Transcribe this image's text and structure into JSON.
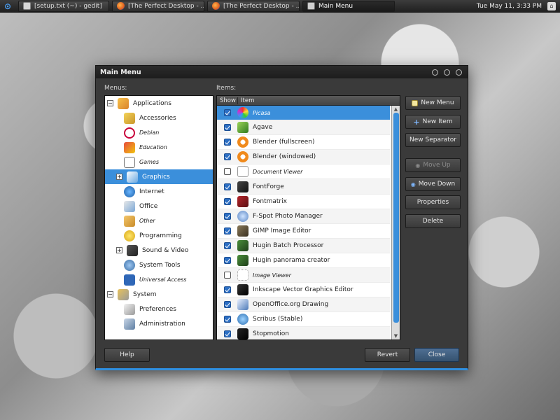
{
  "panel": {
    "tasks": [
      {
        "label": "[setup.txt (~) - gedit]",
        "icon": "document-icon"
      },
      {
        "label": "[The Perfect Desktop - ...",
        "icon": "firefox-icon"
      },
      {
        "label": "[The Perfect Desktop - ...",
        "icon": "firefox-icon"
      },
      {
        "label": "Main Menu",
        "icon": "menu-editor-icon"
      }
    ],
    "clock": "Tue May 11,  3:33 PM"
  },
  "window": {
    "title": "Main Menu",
    "menus_label": "Menus:",
    "items_label": "Items:",
    "menus": [
      {
        "label": "Applications",
        "expander": "−",
        "level": 0
      },
      {
        "label": "Accessories",
        "level": 1
      },
      {
        "label": "Debian",
        "level": 1,
        "italic": true
      },
      {
        "label": "Education",
        "level": 1,
        "italic": true
      },
      {
        "label": "Games",
        "level": 1,
        "italic": true
      },
      {
        "label": "Graphics",
        "expander": "+",
        "level": 1,
        "selected": true
      },
      {
        "label": "Internet",
        "level": 1
      },
      {
        "label": "Office",
        "level": 1
      },
      {
        "label": "Other",
        "level": 1,
        "italic": true
      },
      {
        "label": "Programming",
        "level": 1
      },
      {
        "label": "Sound & Video",
        "expander": "+",
        "level": 1
      },
      {
        "label": "System Tools",
        "level": 1
      },
      {
        "label": "Universal Access",
        "level": 1,
        "italic": true
      },
      {
        "label": "System",
        "expander": "−",
        "level": 0
      },
      {
        "label": "Preferences",
        "level": 1
      },
      {
        "label": "Administration",
        "level": 1
      }
    ],
    "items_header": {
      "show": "Show",
      "item": "Item"
    },
    "items": [
      {
        "label": "Picasa",
        "checked": true,
        "italic": true,
        "selected": true
      },
      {
        "label": "Agave",
        "checked": true
      },
      {
        "label": "Blender (fullscreen)",
        "checked": true
      },
      {
        "label": "Blender (windowed)",
        "checked": true
      },
      {
        "label": "Document Viewer",
        "checked": false,
        "italic": true
      },
      {
        "label": "FontForge",
        "checked": true
      },
      {
        "label": "Fontmatrix",
        "checked": true
      },
      {
        "label": "F-Spot Photo Manager",
        "checked": true
      },
      {
        "label": "GIMP Image Editor",
        "checked": true
      },
      {
        "label": "Hugin Batch Processor",
        "checked": true
      },
      {
        "label": "Hugin panorama creator",
        "checked": true
      },
      {
        "label": "Image Viewer",
        "checked": false,
        "italic": true
      },
      {
        "label": "Inkscape Vector Graphics Editor",
        "checked": true
      },
      {
        "label": "OpenOffice.org Drawing",
        "checked": true
      },
      {
        "label": "Scribus (Stable)",
        "checked": true
      },
      {
        "label": "Stopmotion",
        "checked": true
      }
    ],
    "buttons": {
      "new_menu": "New Menu",
      "new_item": "New Item",
      "new_separator": "New Separator",
      "move_up": "Move Up",
      "move_down": "Move Down",
      "properties": "Properties",
      "delete": "Delete",
      "help": "Help",
      "revert": "Revert",
      "close": "Close"
    }
  },
  "colors": {
    "selection": "#3b8fdb",
    "window_bg": "#3a3a3a",
    "accent_border": "#2f8fe0"
  }
}
